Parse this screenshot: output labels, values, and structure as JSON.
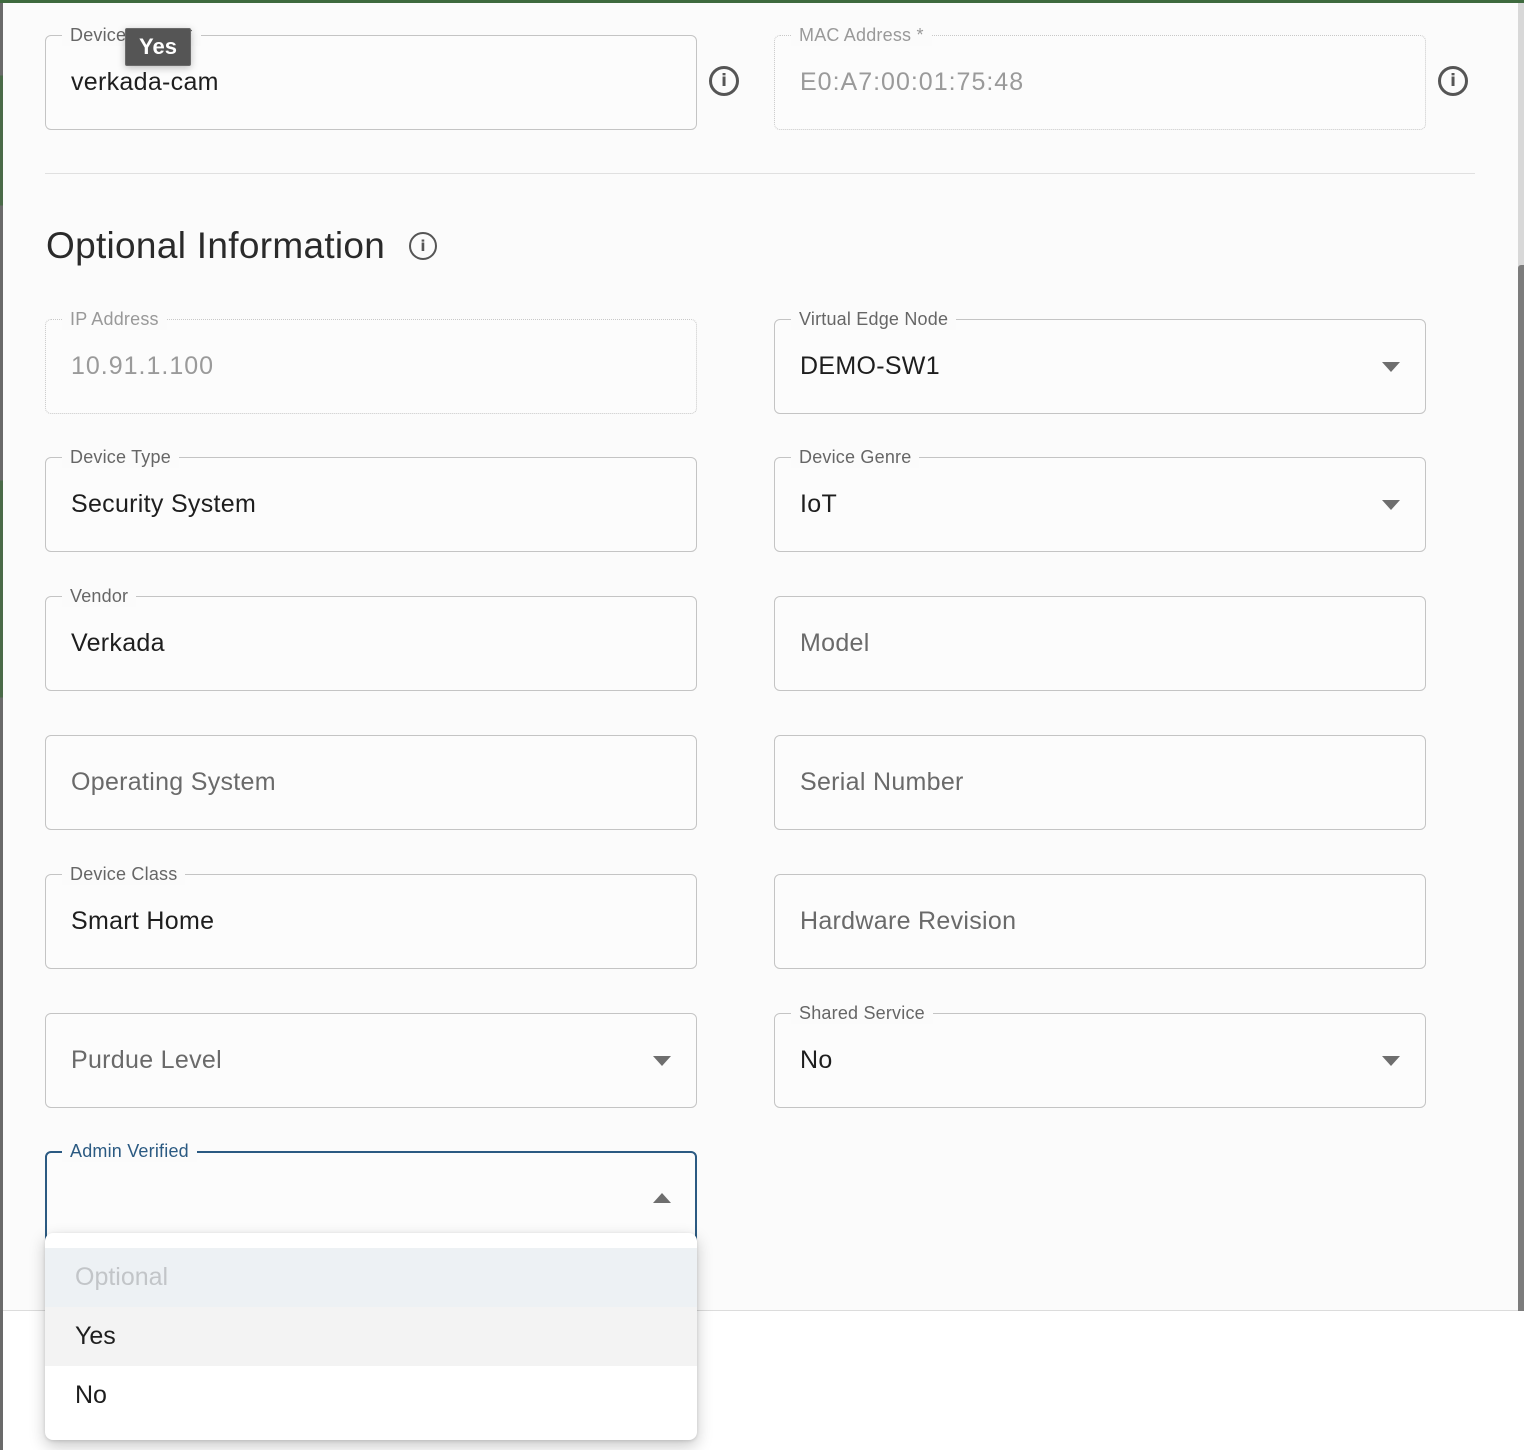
{
  "tooltip": {
    "text": "Yes"
  },
  "required_section": {
    "device_name": {
      "label": "Device Name *",
      "value": "verkada-cam"
    },
    "mac_address": {
      "label": "MAC Address *",
      "value": "E0:A7:00:01:75:48",
      "disabled": true
    }
  },
  "optional_section": {
    "title": "Optional Information",
    "fields": {
      "ip_address": {
        "label": "IP Address",
        "value": "10.91.1.100",
        "disabled": true
      },
      "virtual_edge_node": {
        "label": "Virtual Edge Node",
        "value": "DEMO-SW1",
        "type": "select"
      },
      "device_type": {
        "label": "Device Type",
        "value": "Security System"
      },
      "device_genre": {
        "label": "Device Genre",
        "value": "IoT",
        "type": "select"
      },
      "vendor": {
        "label": "Vendor",
        "value": "Verkada"
      },
      "model": {
        "placeholder": "Model"
      },
      "operating_system": {
        "placeholder": "Operating System"
      },
      "serial_number": {
        "placeholder": "Serial Number"
      },
      "device_class": {
        "label": "Device Class",
        "value": "Smart Home"
      },
      "hardware_revision": {
        "placeholder": "Hardware Revision"
      },
      "purdue_level": {
        "placeholder": "Purdue Level",
        "type": "select"
      },
      "shared_service": {
        "label": "Shared Service",
        "value": "No",
        "type": "select"
      },
      "admin_verified": {
        "label": "Admin Verified",
        "value": "",
        "type": "select",
        "open": true,
        "options": [
          {
            "label": "Optional",
            "disabled": true
          },
          {
            "label": "Yes",
            "hovered": true
          },
          {
            "label": "No"
          }
        ]
      }
    }
  },
  "colors": {
    "accent": "#2b5a82",
    "top_bar": "#3e6a3e"
  }
}
